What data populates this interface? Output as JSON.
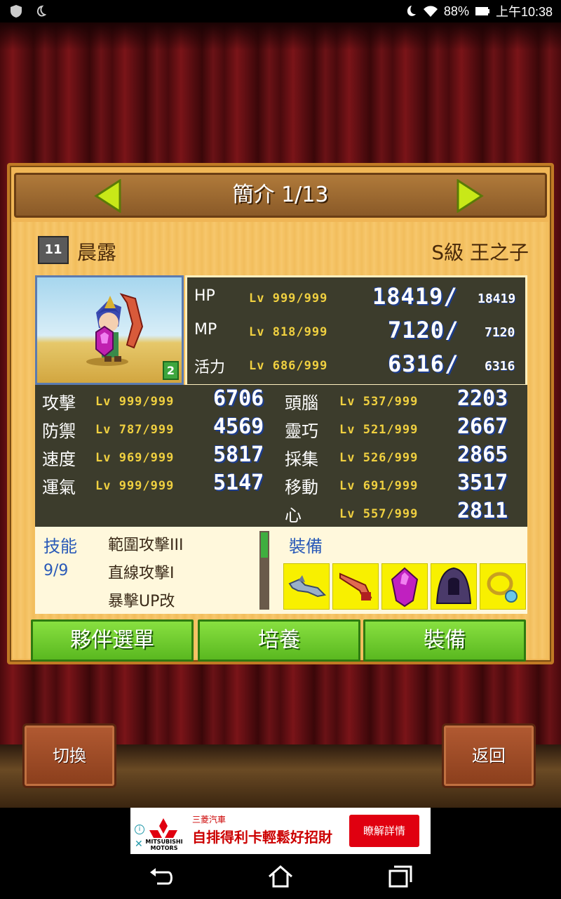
{
  "status_bar": {
    "battery": "88%",
    "time": "上午10:38"
  },
  "header": {
    "title": "簡介 1/13"
  },
  "character": {
    "rank_badge": "11",
    "name": "晨露",
    "class": "S級 王之子",
    "portrait_level": "2"
  },
  "vitals": [
    {
      "label": "HP",
      "lv": "Lv 999/999",
      "current": "18419/",
      "max": "18419"
    },
    {
      "label": "MP",
      "lv": "Lv 818/999",
      "current": "7120/",
      "max": "7120"
    },
    {
      "label": "活力",
      "lv": "Lv 686/999",
      "current": "6316/",
      "max": "6316"
    }
  ],
  "stats_left": [
    {
      "label": "攻擊",
      "lv": "Lv 999/999",
      "value": "6706"
    },
    {
      "label": "防禦",
      "lv": "Lv 787/999",
      "value": "4569"
    },
    {
      "label": "速度",
      "lv": "Lv 969/999",
      "value": "5817"
    },
    {
      "label": "運氣",
      "lv": "Lv 999/999",
      "value": "5147"
    }
  ],
  "stats_right": [
    {
      "label": "頭腦",
      "lv": "Lv 537/999",
      "value": "2203"
    },
    {
      "label": "靈巧",
      "lv": "Lv 521/999",
      "value": "2667"
    },
    {
      "label": "採集",
      "lv": "Lv 526/999",
      "value": "2865"
    },
    {
      "label": "移動",
      "lv": "Lv 691/999",
      "value": "3517"
    },
    {
      "label": "心",
      "lv": "Lv 557/999",
      "value": "2811"
    }
  ],
  "skills": {
    "title": "技能",
    "count": "9/9",
    "items": [
      "範圍攻擊III",
      "直線攻擊I",
      "暴擊UP改"
    ]
  },
  "equipment": {
    "title": "裝備",
    "items": [
      "bird-icon",
      "feather-blade-icon",
      "purple-gem-icon",
      "dark-hood-icon",
      "ring-icon"
    ]
  },
  "buttons": {
    "party_menu": "夥伴選單",
    "train": "培養",
    "equip": "裝備",
    "switch": "切換",
    "back": "返回"
  },
  "ad": {
    "brand_logo_text": "MITSUBISHI MOTORS",
    "brand": "三菱汽車",
    "headline": "自排得利卡輕鬆好招財",
    "cta": "瞭解詳情"
  },
  "colors": {
    "panel": "#f0b656",
    "stat_box": "#3c3c2c",
    "green_button": "#5ab820",
    "brown_button": "#8a3e1c",
    "equip_slot": "#f8f000"
  }
}
